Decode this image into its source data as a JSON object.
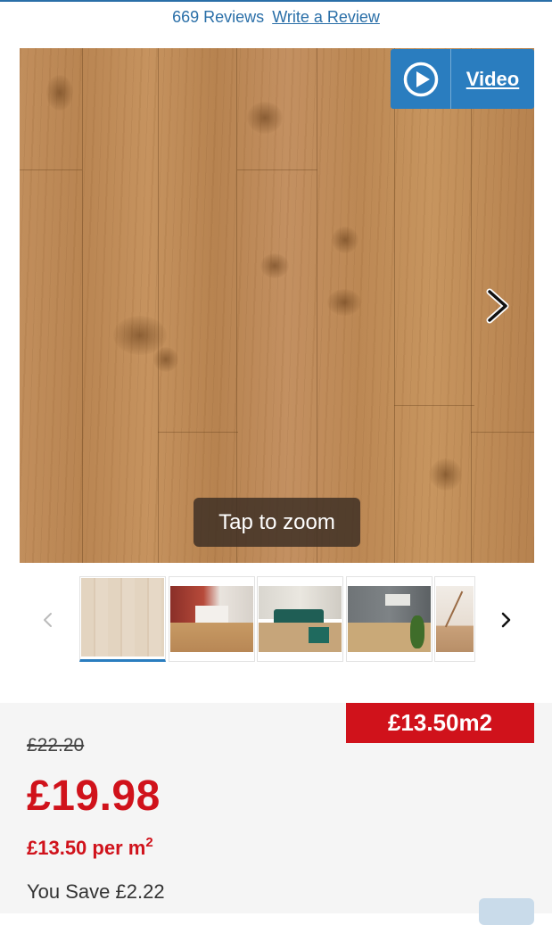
{
  "reviews": {
    "count_text": "669 Reviews",
    "write_link": "Write a Review"
  },
  "video_button": {
    "label": "Video",
    "icon": "play-circle-icon"
  },
  "hero_image": {
    "overlay_text": "Tap to zoom",
    "next_icon": "chevron-right-icon"
  },
  "thumbnails": {
    "prev_icon": "chevron-left-icon",
    "next_icon": "chevron-right-icon",
    "items": [
      "wood-swatch-thumbnail",
      "kitchen-room-thumbnail",
      "living-room-thumbnail",
      "lounge-room-thumbnail",
      "hallway-stairs-thumbnail"
    ],
    "active_index": 0
  },
  "pricing": {
    "promo_badge": "£13.50m2",
    "old_price": "£22.20",
    "price": "£19.98",
    "per_unit_amount": "£13.50 per m",
    "per_unit_superscript": "2",
    "savings": "You Save £2.22"
  },
  "colors": {
    "brand_blue": "#2a7dbf",
    "sale_red": "#d0121b",
    "panel_bg": "#f5f5f5"
  }
}
